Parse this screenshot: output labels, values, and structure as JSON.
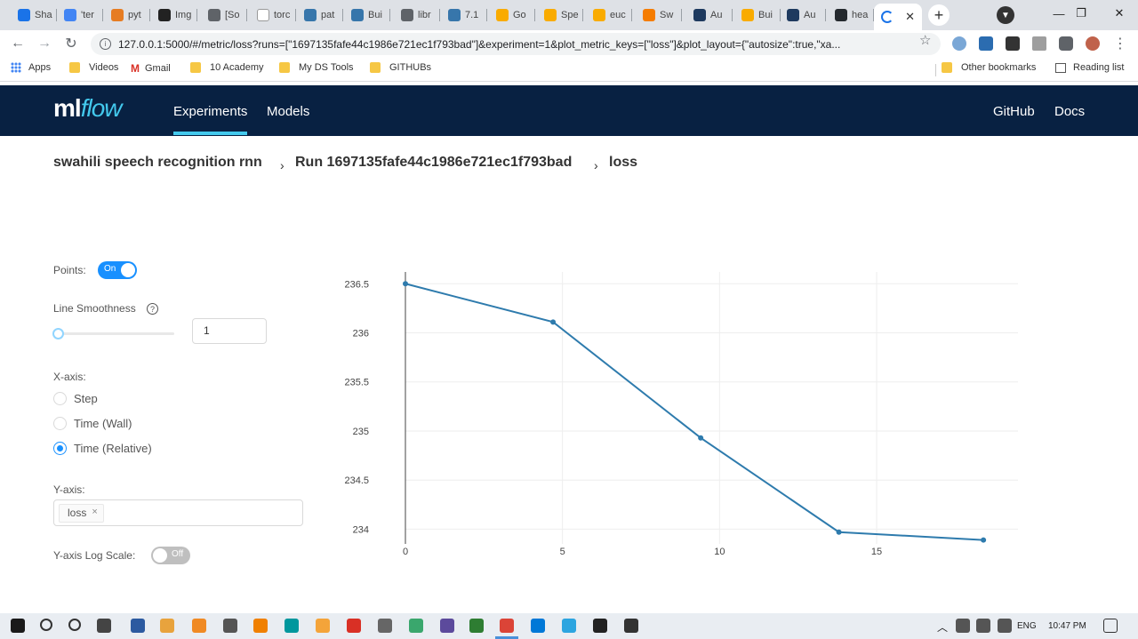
{
  "browser": {
    "tabs": [
      {
        "title": "Sha",
        "color": "#1a73e8"
      },
      {
        "title": "'ter",
        "color": "#4285f4"
      },
      {
        "title": "pyt",
        "color": "#e67c22"
      },
      {
        "title": "Img",
        "color": "#222222"
      },
      {
        "title": "[So",
        "color": "#5f6368"
      },
      {
        "title": "torc",
        "color": "#ffffff"
      },
      {
        "title": "pat",
        "color": "#3776ab"
      },
      {
        "title": "Bui",
        "color": "#3776ab"
      },
      {
        "title": "libr",
        "color": "#5f6368"
      },
      {
        "title": "7.1",
        "color": "#3776ab"
      },
      {
        "title": "Go",
        "color": "#f9ab00"
      },
      {
        "title": "Spe",
        "color": "#f9ab00"
      },
      {
        "title": "euc",
        "color": "#f9ab00"
      },
      {
        "title": "Sw",
        "color": "#f57c00"
      },
      {
        "title": "Au",
        "color": "#1e3a5f"
      },
      {
        "title": "Bui",
        "color": "#f9ab00"
      },
      {
        "title": "Au",
        "color": "#1e3a5f"
      },
      {
        "title": "hea",
        "color": "#24292e"
      }
    ],
    "active_tab_close": "✕",
    "new_tab": "+",
    "window_controls": {
      "minimize": "—",
      "restore": "❐",
      "close": "✕"
    },
    "url": "127.0.0.1:5000/#/metric/loss?runs=[\"1697135fafe44c1986e721ec1f793bad\"]&experiment=1&plot_metric_keys=[\"loss\"]&plot_layout={\"autosize\":true,\"xa...",
    "nav": {
      "back": "←",
      "forward": "→",
      "reload": "↻",
      "star": "☆",
      "menu": "⋮"
    },
    "bookmarks": {
      "apps": "Apps",
      "videos": "Videos",
      "gmail": "Gmail",
      "academy": "10 Academy",
      "ds_tools": "My DS Tools",
      "githubs": "GITHUBs",
      "other": "Other bookmarks",
      "reading_list": "Reading list"
    }
  },
  "mlflow": {
    "logo_ml": "ml",
    "logo_flow": "flow",
    "nav": {
      "experiments": "Experiments",
      "models": "Models",
      "github": "GitHub",
      "docs": "Docs"
    },
    "breadcrumb": {
      "experiment": "swahili speech recognition rnn",
      "run": "Run 1697135fafe44c1986e721ec1f793bad",
      "metric": "loss",
      "separator": "›"
    },
    "controls": {
      "points_label": "Points:",
      "points_toggle": "On",
      "smoothness_label": "Line Smoothness",
      "help": "?",
      "smoothness_value": "1",
      "xaxis_label": "X-axis:",
      "xaxis_options": [
        "Step",
        "Time (Wall)",
        "Time (Relative)"
      ],
      "xaxis_selected": 2,
      "yaxis_label": "Y-axis:",
      "yaxis_tag": "loss",
      "yaxis_tag_remove": "×",
      "log_scale_label": "Y-axis Log Scale:",
      "log_scale_toggle": "Off"
    }
  },
  "chart_data": {
    "type": "line",
    "series": [
      {
        "x": [
          0,
          4.7,
          9.4,
          13.8,
          18.4
        ],
        "y": [
          236.5,
          236.11,
          234.93,
          233.97,
          233.89
        ]
      }
    ],
    "xlim": [
      0,
      19.5
    ],
    "ylim": [
      233.85,
      236.62
    ],
    "x_ticks": [
      0,
      5,
      10,
      15
    ],
    "y_ticks": [
      236.5,
      236,
      235.5,
      235,
      234.5,
      234
    ],
    "y_tick_labels": [
      "236.5",
      "236",
      "235.5",
      "235",
      "234.5",
      "234"
    ],
    "grid": true,
    "line_color": "#2e7bad"
  },
  "taskbar": {
    "clock": "10:47 PM",
    "lang": "ENG",
    "tray_up": "︿"
  }
}
